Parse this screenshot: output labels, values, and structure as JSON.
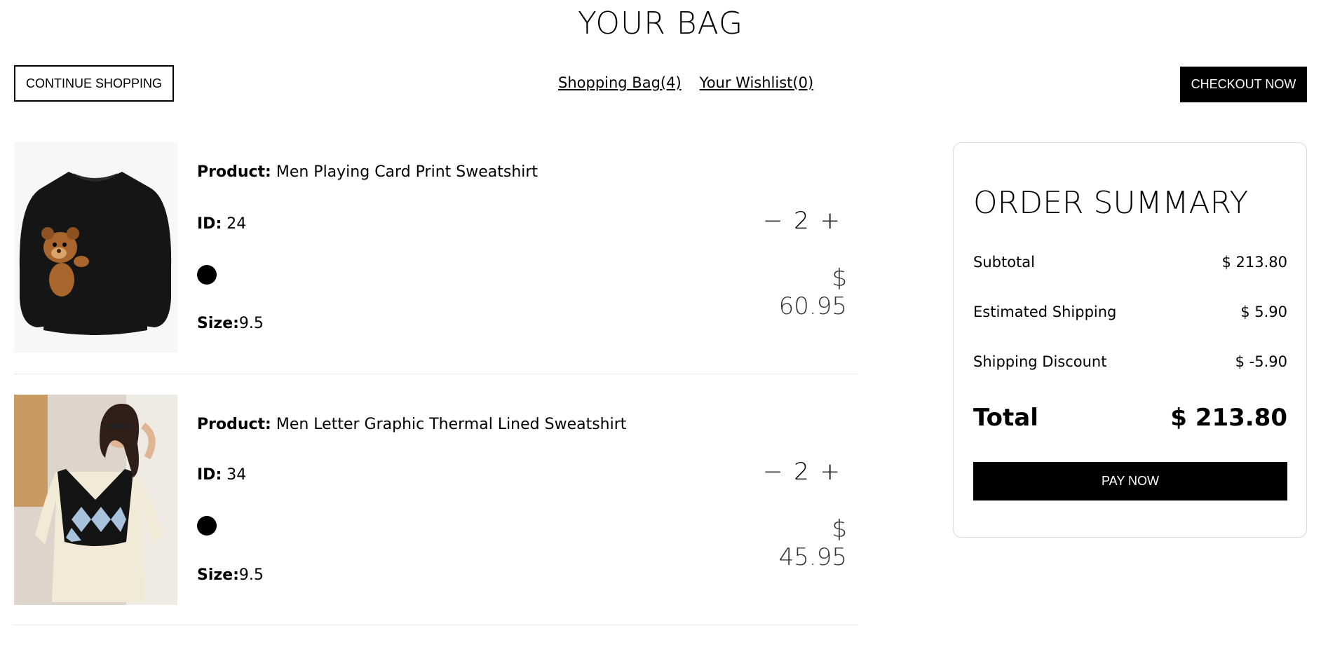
{
  "page": {
    "title": "YOUR BAG"
  },
  "top": {
    "continue_label": "CONTINUE SHOPPING",
    "bag_link": "Shopping Bag(4)",
    "wishlist_link": "Your Wishlist(0)",
    "checkout_label": "CHECKOUT NOW"
  },
  "products": [
    {
      "product_label": "Product:",
      "name": " Men Playing Card Print Sweatshirt",
      "id_label": "ID:",
      "id": " 24",
      "color": "#000000",
      "size_label": "Size:",
      "size": "9.5",
      "qty": "2",
      "price": "$ 60.95"
    },
    {
      "product_label": "Product:",
      "name": " Men Letter Graphic Thermal Lined Sweatshirt",
      "id_label": "ID:",
      "id": " 34",
      "color": "#000000",
      "size_label": "Size:",
      "size": "9.5",
      "qty": "2",
      "price": "$ 45.95"
    }
  ],
  "qty_controls": {
    "minus": "−",
    "plus": "+"
  },
  "summary": {
    "title": "ORDER SUMMARY",
    "subtotal_label": "Subtotal",
    "subtotal": "$ 213.80",
    "shipping_label": "Estimated Shipping",
    "shipping": "$ 5.90",
    "discount_label": "Shipping Discount",
    "discount": "$ -5.90",
    "total_label": "Total",
    "total": "$ 213.80",
    "pay_label": "PAY NOW"
  }
}
